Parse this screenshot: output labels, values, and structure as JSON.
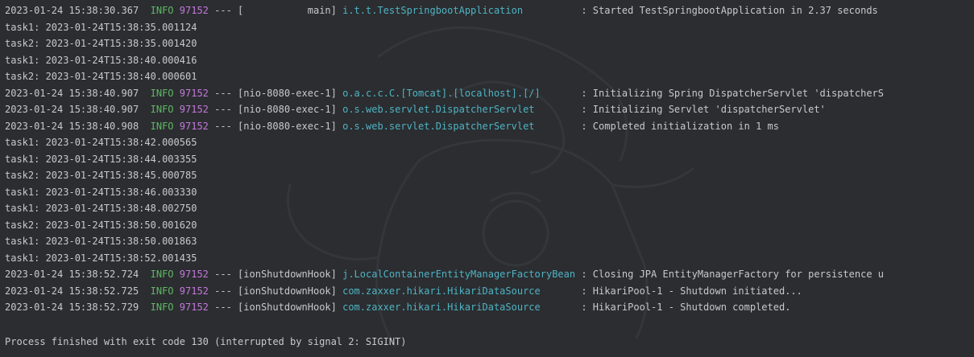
{
  "colors": {
    "background": "#2b2d30",
    "text": "#c7c9cc",
    "level_info": "#5fb865",
    "pid": "#c678dd",
    "logger": "#4fb3c4"
  },
  "log_lines": [
    {
      "type": "log",
      "timestamp": "2023-01-24 15:38:30.367",
      "level": "INFO",
      "pid": "97152",
      "dashes": "---",
      "thread": "[           main]",
      "logger": "i.t.t.TestSpringbootApplication",
      "message": ": Started TestSpringbootApplication in 2.37 seconds"
    },
    {
      "type": "task",
      "text": "task1: 2023-01-24T15:38:35.001124"
    },
    {
      "type": "task",
      "text": "task2: 2023-01-24T15:38:35.001420"
    },
    {
      "type": "task",
      "text": "task1: 2023-01-24T15:38:40.000416"
    },
    {
      "type": "task",
      "text": "task2: 2023-01-24T15:38:40.000601"
    },
    {
      "type": "log",
      "timestamp": "2023-01-24 15:38:40.907",
      "level": "INFO",
      "pid": "97152",
      "dashes": "---",
      "thread": "[nio-8080-exec-1]",
      "logger": "o.a.c.c.C.[Tomcat].[localhost].[/]",
      "message": ": Initializing Spring DispatcherServlet 'dispatcherS"
    },
    {
      "type": "log",
      "timestamp": "2023-01-24 15:38:40.907",
      "level": "INFO",
      "pid": "97152",
      "dashes": "---",
      "thread": "[nio-8080-exec-1]",
      "logger": "o.s.web.servlet.DispatcherServlet",
      "message": ": Initializing Servlet 'dispatcherServlet'"
    },
    {
      "type": "log",
      "timestamp": "2023-01-24 15:38:40.908",
      "level": "INFO",
      "pid": "97152",
      "dashes": "---",
      "thread": "[nio-8080-exec-1]",
      "logger": "o.s.web.servlet.DispatcherServlet",
      "message": ": Completed initialization in 1 ms"
    },
    {
      "type": "task",
      "text": "task1: 2023-01-24T15:38:42.000565"
    },
    {
      "type": "task",
      "text": "task1: 2023-01-24T15:38:44.003355"
    },
    {
      "type": "task",
      "text": "task2: 2023-01-24T15:38:45.000785"
    },
    {
      "type": "task",
      "text": "task1: 2023-01-24T15:38:46.003330"
    },
    {
      "type": "task",
      "text": "task1: 2023-01-24T15:38:48.002750"
    },
    {
      "type": "task",
      "text": "task2: 2023-01-24T15:38:50.001620"
    },
    {
      "type": "task",
      "text": "task1: 2023-01-24T15:38:50.001863"
    },
    {
      "type": "task",
      "text": "task1: 2023-01-24T15:38:52.001435"
    },
    {
      "type": "log",
      "timestamp": "2023-01-24 15:38:52.724",
      "level": "INFO",
      "pid": "97152",
      "dashes": "---",
      "thread": "[ionShutdownHook]",
      "logger": "j.LocalContainerEntityManagerFactoryBean",
      "message": ": Closing JPA EntityManagerFactory for persistence u"
    },
    {
      "type": "log",
      "timestamp": "2023-01-24 15:38:52.725",
      "level": "INFO",
      "pid": "97152",
      "dashes": "---",
      "thread": "[ionShutdownHook]",
      "logger": "com.zaxxer.hikari.HikariDataSource",
      "message": ": HikariPool-1 - Shutdown initiated..."
    },
    {
      "type": "log",
      "timestamp": "2023-01-24 15:38:52.729",
      "level": "INFO",
      "pid": "97152",
      "dashes": "---",
      "thread": "[ionShutdownHook]",
      "logger": "com.zaxxer.hikari.HikariDataSource",
      "message": ": HikariPool-1 - Shutdown completed."
    },
    {
      "type": "blank"
    }
  ],
  "process_status": "Process finished with exit code 130 (interrupted by signal 2: SIGINT)"
}
